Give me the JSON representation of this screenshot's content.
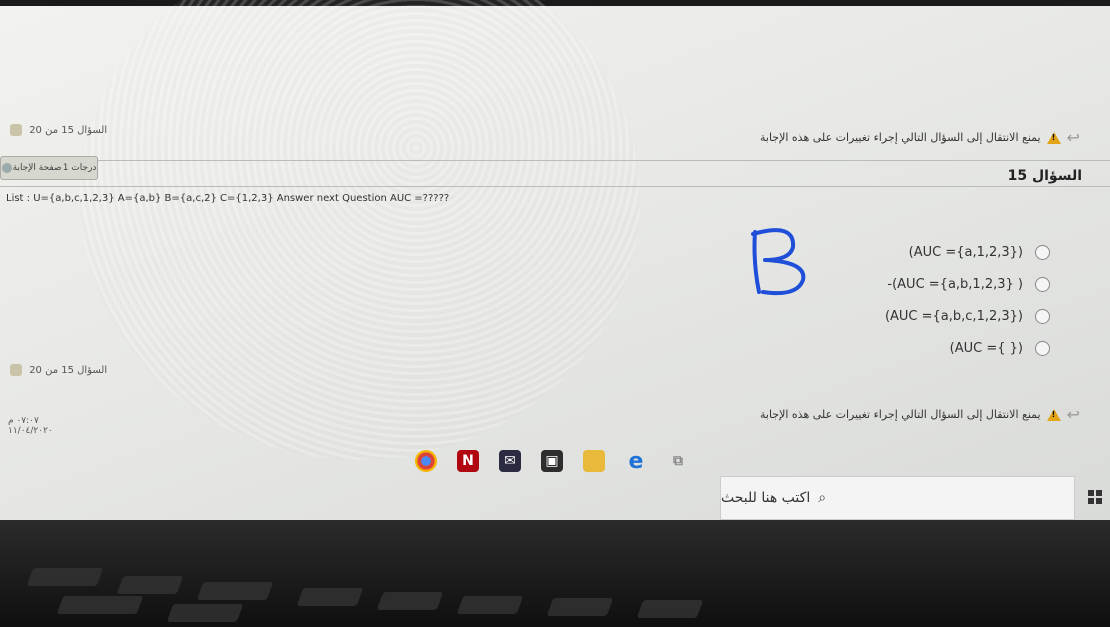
{
  "pager": {
    "top": "السؤال 15 من 20",
    "bottom": "السؤال 15 من 20"
  },
  "warning": {
    "top": "يمنع الانتقال إلى السؤال التالي إجراء تغييرات على هذه الإجابة",
    "bottom": "يمنع الانتقال إلى السؤال التالي إجراء تغييرات على هذه الإجابة"
  },
  "side_tab": {
    "points": "1 درجات",
    "label": "صفحة الإجابة"
  },
  "question": {
    "title": "السؤال 15",
    "text": "List : U={a,b,c,1,2,3} A={a,b} B={a,c,2} C={1,2,3} Answer next Question AUC =?????",
    "options": [
      "(AUC ={a,1,2,3})",
      "-(AUC ={a,b,1,2,3} )",
      "(AUC ={a,b,c,1,2,3})",
      "(AUC ={ })"
    ]
  },
  "annotation": "B",
  "tray": {
    "time": "٠٧:٠٧ م",
    "date": "١١/٠٤/٢٠٢٠"
  },
  "taskbar": {
    "search_placeholder": "اكتب هنا للبحث",
    "apps": [
      "chrome-icon",
      "netflix-icon",
      "mail-icon",
      "store-icon",
      "explorer-icon",
      "edge-icon",
      "task-view-icon"
    ]
  },
  "colors": {
    "warning": "#e3a417",
    "ink": "#1f4fd8"
  }
}
